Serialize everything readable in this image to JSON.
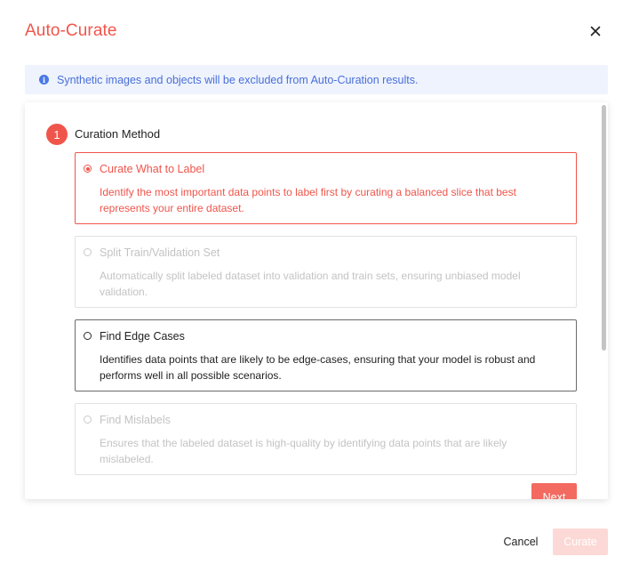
{
  "dialog": {
    "title": "Auto-Curate",
    "close_icon": "close-icon"
  },
  "info_banner": {
    "icon": "info-icon",
    "icon_glyph": "i",
    "text": "Synthetic images and objects will be excluded from Auto-Curation results."
  },
  "step": {
    "number": "1",
    "label": "Curation Method"
  },
  "options": [
    {
      "title": "Curate What to Label",
      "description": "Identify the most important data points to label first by curating a balanced slice that best represents your entire dataset.",
      "state": "selected"
    },
    {
      "title": "Split Train/Validation Set",
      "description": "Automatically split labeled dataset into validation and train sets, ensuring unbiased model validation.",
      "state": "disabled"
    },
    {
      "title": "Find Edge Cases",
      "description": "Identifies data points that are likely to be edge-cases, ensuring that your model is robust and performs well in all possible scenarios.",
      "state": "enabled"
    },
    {
      "title": "Find Mislabels",
      "description": "Ensures that the labeled dataset is high-quality by identifying data points that are likely mislabeled.",
      "state": "disabled"
    }
  ],
  "next_label": "Next",
  "footer": {
    "cancel_label": "Cancel",
    "curate_label": "Curate"
  },
  "colors": {
    "accent": "#f0554b",
    "info_bg": "#eef3fd",
    "info_text": "#4a6fd8",
    "disabled_text": "#c3c3c3",
    "curate_disabled_bg": "#fcd9d6"
  }
}
